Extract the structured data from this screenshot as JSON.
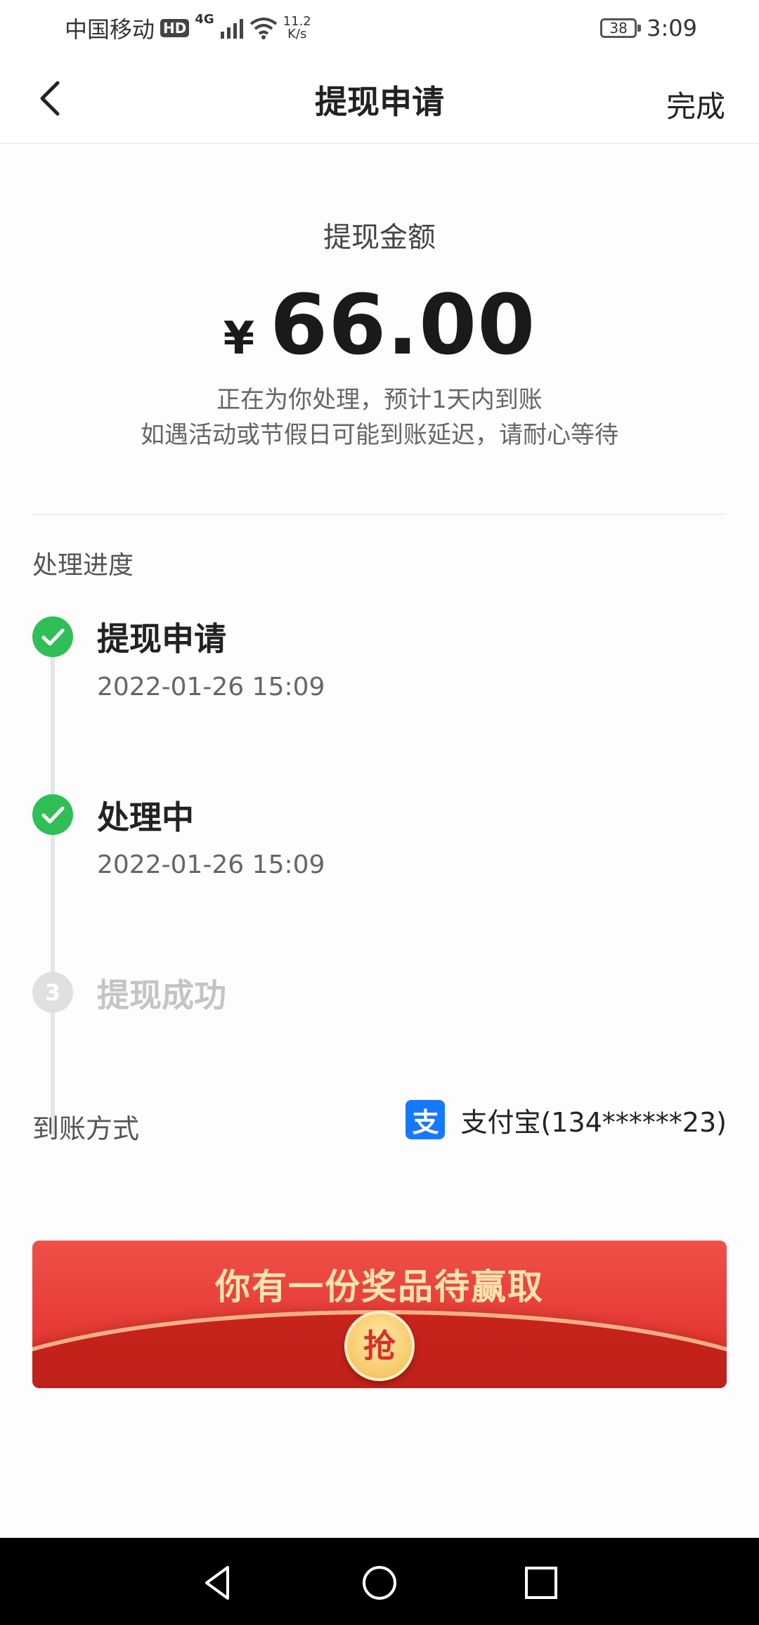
{
  "status_bar": {
    "carrier": "中国移动",
    "hd_badge": "HD",
    "network": "4G",
    "speed_value": "11.2",
    "speed_unit": "K/s",
    "battery": "38",
    "time": "3:09"
  },
  "nav": {
    "title": "提现申请",
    "done_label": "完成"
  },
  "amount": {
    "label": "提现金额",
    "currency": "¥",
    "value": "66.00",
    "note_line1": "正在为你处理，预计1天内到账",
    "note_line2": "如遇活动或节假日可能到账延迟，请耐心等待"
  },
  "progress": {
    "title": "处理进度",
    "steps": [
      {
        "title": "提现申请",
        "time": "2022-01-26 15:09",
        "status": "done"
      },
      {
        "title": "处理中",
        "time": "2022-01-26 15:09",
        "status": "done"
      },
      {
        "title": "提现成功",
        "number": "3",
        "status": "pending"
      }
    ]
  },
  "payout": {
    "label": "到账方式",
    "method": "支付宝(134******23)",
    "icon": "alipay-icon",
    "icon_glyph": "支"
  },
  "banner": {
    "text": "你有一份奖品待赢取",
    "button_label": "抢"
  },
  "colors": {
    "success": "#2fbf56",
    "banner_red": "#e63a35",
    "alipay_blue": "#1678ff"
  }
}
